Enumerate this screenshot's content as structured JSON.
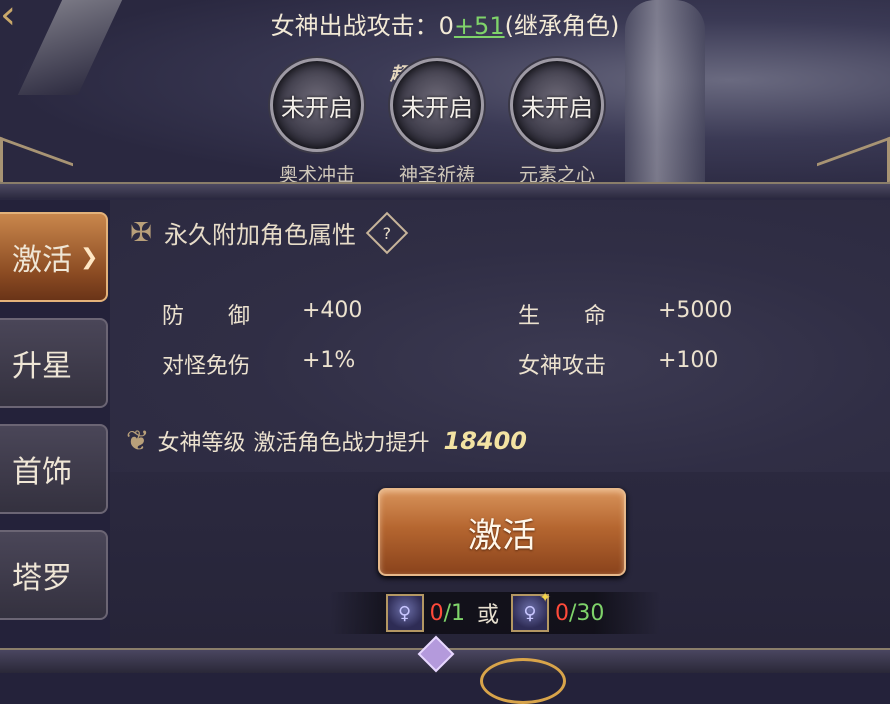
{
  "header": {
    "attack_label": "女神出战攻击：",
    "attack_base": "0",
    "attack_bonus": "+51",
    "attack_note": "(继承角色)",
    "super_tag": "超"
  },
  "skills": [
    {
      "status": "未开启",
      "name": "奥术冲击"
    },
    {
      "status": "未开启",
      "name": "神圣祈祷"
    },
    {
      "status": "未开启",
      "name": "元素之心"
    }
  ],
  "tabs": [
    {
      "label": "激活",
      "active": true
    },
    {
      "label": "升星",
      "active": false
    },
    {
      "label": "首饰",
      "active": false
    },
    {
      "label": "塔罗",
      "active": false
    }
  ],
  "attributes": {
    "title": "永久附加角色属性",
    "help": "?",
    "rows": [
      {
        "label": "防　　御",
        "value": "+400"
      },
      {
        "label": "生　　命",
        "value": "+5000"
      },
      {
        "label": "对怪免伤",
        "value": "+1%"
      },
      {
        "label": "女神攻击",
        "value": "+100"
      }
    ]
  },
  "level": {
    "label": "女神等级",
    "desc": "激活角色战力提升",
    "power": "18400"
  },
  "activate_button": "激活",
  "cost": {
    "item1_have": "0",
    "item1_need": "/1",
    "or": "或",
    "item2_have": "0",
    "item2_need": "/30"
  },
  "icons": {
    "emblem": "emblem-icon",
    "help": "help-diamond-icon",
    "wing": "wing-icon",
    "chevron": "chevron-right-icon"
  },
  "colors": {
    "accent": "#c9874c",
    "bonus_green": "#7fd36a",
    "cost_red": "#ff4a3a",
    "power_gold": "#f3e3a3"
  }
}
